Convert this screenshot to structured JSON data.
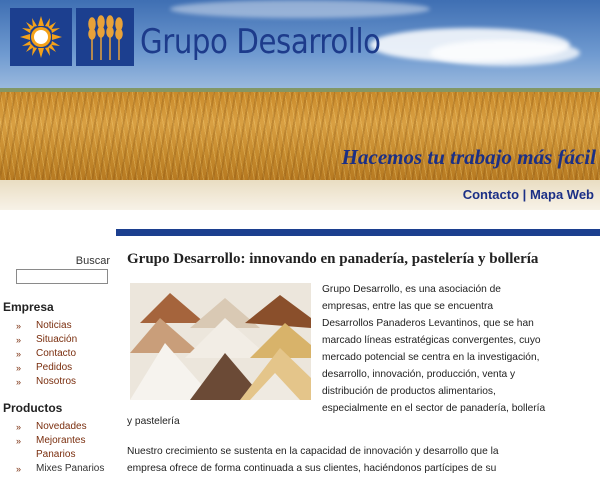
{
  "header": {
    "logo_sun_icon": "sun-logo-icon",
    "logo_wheat_icon": "wheat-logo-icon",
    "brand": "Grupo Desarrollo",
    "tagline": "Hacemos tu trabajo más fácil",
    "colors": {
      "brand_blue": "#1c3f8f",
      "tagline_blue": "#1b2f86"
    }
  },
  "topnav": {
    "contacto": "Contacto",
    "separator": "|",
    "mapa": "Mapa Web"
  },
  "sidebar": {
    "search_label": "Buscar",
    "search_value": "",
    "sections": [
      {
        "title": "Empresa",
        "items": [
          "Noticias",
          "Situación",
          "Contacto",
          "Pedidos",
          "Nosotros"
        ]
      },
      {
        "title": "Productos",
        "items": [
          "Novedades",
          "Mejorantes",
          "Panarios",
          "Mixes Panarios"
        ]
      }
    ],
    "colors": {
      "link": "#7a2e0e"
    }
  },
  "main": {
    "title": "Grupo Desarrollo: innovando en panadería, pastelería y bollería",
    "para1_lines": [
      "Grupo Desarrollo, es una asociación de",
      "empresas, entre las que se encuentra",
      "Desarrollos Panaderos Levantinos, que se han",
      "marcado líneas estratégicas convergentes, cuyo",
      "mercado potencial se centra en la investigación,",
      "desarrollo, innovación, producción, venta y",
      "distribución de productos alimentarios,",
      "especialmente en el sector de panadería, bollería"
    ],
    "para1_tail": "y pastelería",
    "para2_lines": [
      "Nuestro crecimiento se sustenta en la capacidad de innovación y desarrollo que la",
      "empresa ofrece de forma continuada a sus clientes, haciéndonos partícipes de su"
    ],
    "image_icon": "flour-piles-image"
  }
}
